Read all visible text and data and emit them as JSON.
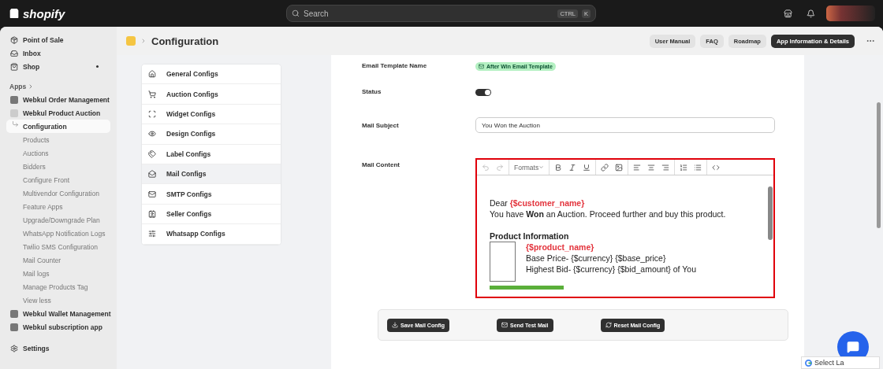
{
  "topbar": {
    "logo": "shopify",
    "search": {
      "placeholder": "Search"
    },
    "shortcut": [
      "CTRL",
      "K"
    ]
  },
  "sidebar": {
    "top_items": [
      {
        "label": "Point of Sale",
        "dot": false
      },
      {
        "label": "Inbox",
        "dot": false
      },
      {
        "label": "Shop",
        "dot": true
      }
    ],
    "apps_label": "Apps",
    "apps": [
      {
        "label": "Webkul Order Management",
        "expanded": false
      },
      {
        "label": "Webkul Product Auction",
        "expanded": true,
        "toggle": "View less",
        "children": [
          {
            "label": "Configuration",
            "selected": true
          },
          {
            "label": "Products",
            "selected": false
          },
          {
            "label": "Auctions",
            "selected": false
          },
          {
            "label": "Bidders",
            "selected": false
          },
          {
            "label": "Configure Front",
            "selected": false
          },
          {
            "label": "Multivendor Configuration",
            "selected": false
          },
          {
            "label": "Feature Apps",
            "selected": false
          },
          {
            "label": "Upgrade/Downgrade Plan",
            "selected": false
          },
          {
            "label": "WhatsApp Notification Logs",
            "selected": false
          },
          {
            "label": "Twilio SMS Configuration",
            "selected": false
          },
          {
            "label": "Mail Counter",
            "selected": false
          },
          {
            "label": "Mail logs",
            "selected": false
          },
          {
            "label": "Manage Products Tag",
            "selected": false
          }
        ]
      },
      {
        "label": "Webkul Wallet Management",
        "expanded": false
      },
      {
        "label": "Webkul subscription app",
        "expanded": false
      }
    ],
    "settings": "Settings"
  },
  "header": {
    "title": "Configuration",
    "buttons": [
      {
        "label": "User Manual",
        "primary": false
      },
      {
        "label": "FAQ",
        "primary": false
      },
      {
        "label": "Roadmap",
        "primary": false
      },
      {
        "label": "App Information & Details",
        "primary": true
      }
    ]
  },
  "config_menu": [
    {
      "label": "General Configs",
      "selected": false
    },
    {
      "label": "Auction Configs",
      "selected": false
    },
    {
      "label": "Widget Configs",
      "selected": false
    },
    {
      "label": "Design Configs",
      "selected": false
    },
    {
      "label": "Label Configs",
      "selected": false
    },
    {
      "label": "Mail Configs",
      "selected": true
    },
    {
      "label": "SMTP Configs",
      "selected": false
    },
    {
      "label": "Seller Configs",
      "selected": false
    },
    {
      "label": "Whatsapp Configs",
      "selected": false
    }
  ],
  "form": {
    "template_label": "Email Template Name",
    "template_name": "After Win Email Template",
    "status_label": "Status",
    "status_on": true,
    "subject_label": "Mail Subject",
    "subject_value": "You Won the Auction",
    "content_label": "Mail Content",
    "editor": {
      "formats": "Formats",
      "greeting": "Dear",
      "customer_var": "{$customer_name}",
      "intro": "You have **Won** an Auction. Proceed further and buy this product.",
      "heading": "Product Information",
      "product_var": "{$product_name}",
      "details": [
        "Base Price- {$currency} {$base_price}",
        "Highest Bid- {$currency} {$bid_amount} of You"
      ]
    }
  },
  "actions": [
    {
      "label": "Save Mail Config"
    },
    {
      "label": "Send Test Mail"
    },
    {
      "label": "Reset Mail Config"
    }
  ],
  "translate": "Select La"
}
